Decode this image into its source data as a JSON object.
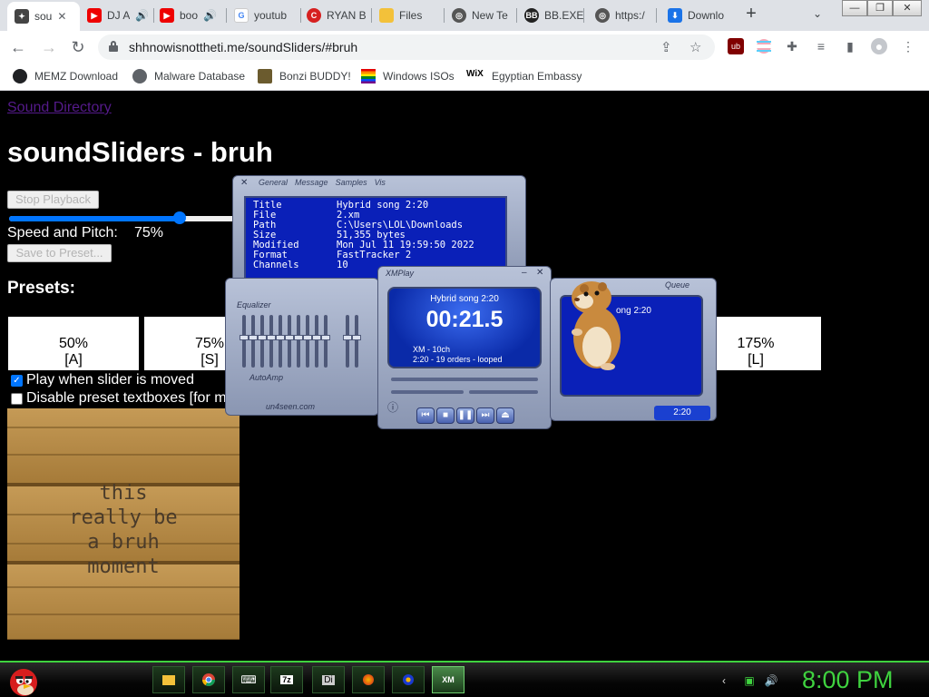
{
  "tabs": [
    {
      "title": "sou",
      "icon": "gear-favicon-icon",
      "active": true
    },
    {
      "title": "DJ A",
      "icon": "youtube-favicon-icon"
    },
    {
      "title": "boo",
      "icon": "youtube-favicon-icon"
    },
    {
      "title": "youtub",
      "icon": "google-favicon-icon"
    },
    {
      "title": "RYAN B",
      "icon": "ryan-favicon-icon"
    },
    {
      "title": "Files",
      "icon": "folder-favicon-icon"
    },
    {
      "title": "New Te",
      "icon": "globe-favicon-icon"
    },
    {
      "title": "BB.EXE",
      "icon": "bb-favicon-icon"
    },
    {
      "title": "https:/",
      "icon": "globe-favicon-icon"
    },
    {
      "title": "Downlo",
      "icon": "download-favicon-icon"
    }
  ],
  "browser": {
    "url": "shhnowisnottheti.me/soundSliders/#bruh"
  },
  "bookmarks": [
    {
      "label": "MEMZ Download"
    },
    {
      "label": "Malware Database"
    },
    {
      "label": "Bonzi BUDDY!"
    },
    {
      "label": "Windows ISOs"
    },
    {
      "label": "Egyptian Embassy"
    }
  ],
  "page": {
    "link": "Sound Directory",
    "title": "soundSliders - bruh",
    "stop_button": "Stop Playback",
    "speed_label": "Speed and Pitch:",
    "speed_value": "75%",
    "slider_fraction": 0.75,
    "save_button": "Save to Preset...",
    "presets_title": "Presets:",
    "presets": [
      {
        "value": "50%",
        "key": "[A]"
      },
      {
        "value": "75%",
        "key": "[S]"
      },
      {
        "value": "175%",
        "key": "[L]"
      }
    ],
    "play_on_move": "Play when slider is moved",
    "disable_textboxes": "Disable preset textboxes [for m",
    "meme_lines": [
      "this",
      "really be",
      "a bruh",
      "moment"
    ]
  },
  "xmplay": {
    "info_tabs": [
      "General",
      "Message",
      "Samples",
      "Vis"
    ],
    "info_rows": [
      {
        "k": "Title",
        "v": "Hybrid song 2:20"
      },
      {
        "k": "File",
        "v": "2.xm"
      },
      {
        "k": "Path",
        "v": "C:\\Users\\LOL\\Downloads"
      },
      {
        "k": "Size",
        "v": "51,355 bytes"
      },
      {
        "k": "Modified",
        "v": "Mon Jul 11 19:59:50 2022"
      },
      {
        "k": "Format",
        "v": "FastTracker 2"
      },
      {
        "k": "Channels",
        "v": "10"
      }
    ],
    "eq_label": "Equalizer",
    "autoamp_label": "AutoAmp",
    "footer": "un4seen.com",
    "player_title": "XMPlay",
    "song": "Hybrid song 2:20",
    "time": "00:21.5",
    "meta1": "XM - 10ch",
    "meta2": "2:20 - 19 orders - looped",
    "queue_label": "Queue",
    "queue_song": "ong 2:20",
    "queue_time": "2:20"
  },
  "taskbar": {
    "apps": [
      {
        "icon": "folder-icon"
      },
      {
        "icon": "chrome-icon"
      },
      {
        "icon": "keyboard-icon"
      },
      {
        "icon": "7zip-icon",
        "label": "7z"
      },
      {
        "icon": "di-icon",
        "label": "Di"
      },
      {
        "icon": "paint-icon"
      },
      {
        "icon": "media-icon"
      },
      {
        "icon": "xmplay-icon",
        "label": "XM"
      }
    ],
    "clock": "8:00 PM"
  },
  "colors": {
    "accent_green": "#3fd23f",
    "link_visited": "#551a8b",
    "checkbox_blue": "#0075ff",
    "xm_screen": "#0a20b8"
  }
}
